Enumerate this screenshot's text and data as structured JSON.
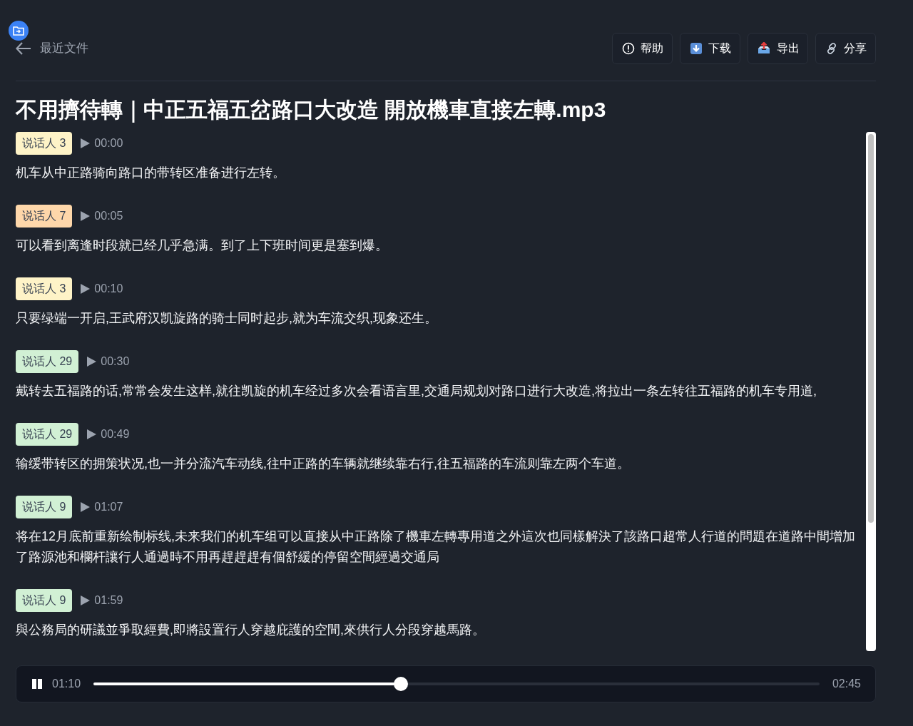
{
  "header": {
    "back_label": "最近文件",
    "buttons": [
      {
        "kind": "help",
        "label": "帮助"
      },
      {
        "kind": "download",
        "label": "下载"
      },
      {
        "kind": "export",
        "label": "导出"
      },
      {
        "kind": "share",
        "label": "分享"
      }
    ]
  },
  "title": "不用擠待轉｜中正五福五岔路口大改造 開放機車直接左轉.mp3",
  "segments": [
    {
      "speaker": "说话人 3",
      "color": "#fef3c7",
      "time": "00:00",
      "text": "机车从中正路骑向路口的带转区准备进行左转。"
    },
    {
      "speaker": "说话人 7",
      "color": "#fed7aa",
      "time": "00:05",
      "text": "可以看到离逢时段就已经几乎急满。到了上下班时间更是塞到爆。"
    },
    {
      "speaker": "说话人 3",
      "color": "#fef3c7",
      "time": "00:10",
      "text": "只要绿端一开启,王武府汉凯旋路的骑士同时起步,就为车流交织,现象还生。"
    },
    {
      "speaker": "说话人 29",
      "color": "#d1f0d4",
      "time": "00:30",
      "text": "戴转去五福路的话,常常会发生这样,就往凯旋的机车经过多次会看语言里,交通局规划对路口进行大改造,将拉出一条左转往五福路的机车专用道,"
    },
    {
      "speaker": "说话人 29",
      "color": "#d1f0d4",
      "time": "00:49",
      "text": "输缓带转区的拥策状况,也一并分流汽车动线,往中正路的车辆就继续靠右行,往五福路的车流则靠左两个车道。"
    },
    {
      "speaker": "说话人 9",
      "color": "#d1f0d4",
      "time": "01:07",
      "text": "将在12月底前重新绘制标线,未来我们的机车组可以直接从中正路除了機車左轉專用道之外這次也同樣解決了該路口超常人行道的問題在道路中間增加了路源池和欄杆讓行人通過時不用再趕趕趕有個舒緩的停留空間經過交通局"
    },
    {
      "speaker": "说话人 9",
      "color": "#d1f0d4",
      "time": "01:59",
      "text": "與公務局的研議並爭取經費,即將設置行人穿越庇護的空間,來供行人分段穿越馬路。"
    }
  ],
  "player": {
    "playing": true,
    "current": "01:10",
    "duration": "02:45",
    "level": 0.423
  }
}
